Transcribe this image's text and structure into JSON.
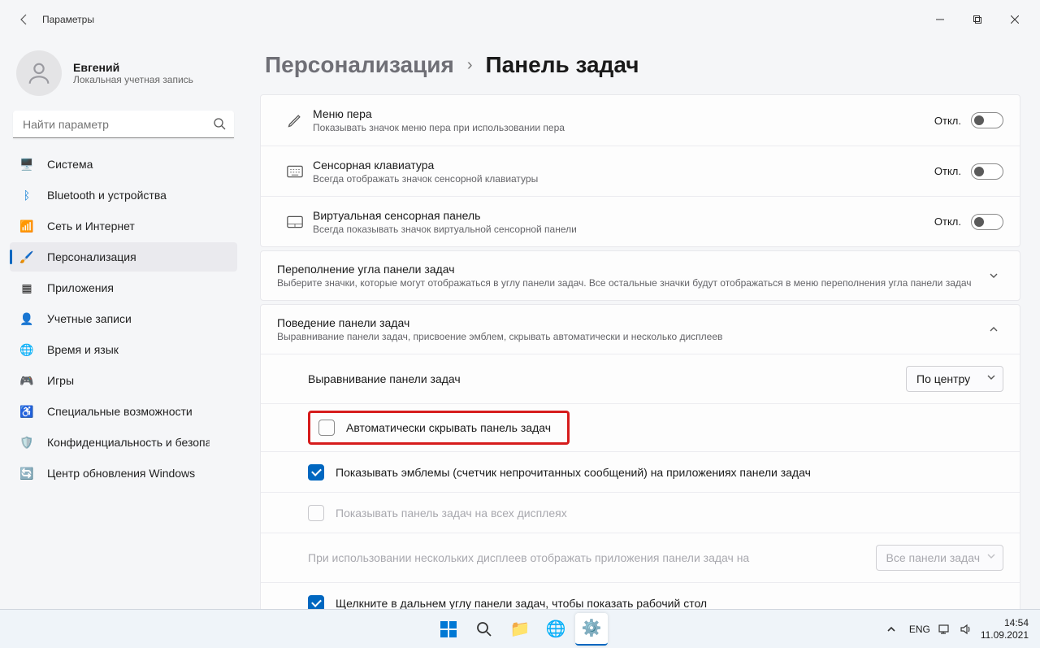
{
  "window": {
    "title": "Параметры"
  },
  "user": {
    "name": "Евгений",
    "subtitle": "Локальная учетная запись"
  },
  "search": {
    "placeholder": "Найти параметр"
  },
  "nav": [
    {
      "label": "Система"
    },
    {
      "label": "Bluetooth и устройства"
    },
    {
      "label": "Сеть и Интернет"
    },
    {
      "label": "Персонализация"
    },
    {
      "label": "Приложения"
    },
    {
      "label": "Учетные записи"
    },
    {
      "label": "Время и язык"
    },
    {
      "label": "Игры"
    },
    {
      "label": "Специальные возможности"
    },
    {
      "label": "Конфиденциальность и безопасность"
    },
    {
      "label": "Центр обновления Windows"
    }
  ],
  "breadcrumb": {
    "parent": "Персонализация",
    "current": "Панель задач"
  },
  "toggles": {
    "off_label": "Откл."
  },
  "items": {
    "pen": {
      "title": "Меню пера",
      "sub": "Показывать значок меню пера при использовании пера"
    },
    "touchkb": {
      "title": "Сенсорная клавиатура",
      "sub": "Всегда отображать значок сенсорной клавиатуры"
    },
    "touchpad": {
      "title": "Виртуальная сенсорная панель",
      "sub": "Всегда показывать значок виртуальной сенсорной панели"
    }
  },
  "overflow": {
    "title": "Переполнение угла панели задач",
    "sub": "Выберите значки, которые могут отображаться в углу панели задач. Все остальные значки будут отображаться в меню переполнения угла панели задач"
  },
  "behavior": {
    "title": "Поведение панели задач",
    "sub": "Выравнивание панели задач, присвоение эмблем, скрывать автоматически и несколько дисплеев",
    "align_label": "Выравнивание панели задач",
    "align_value": "По центру",
    "autohide": "Автоматически скрывать панель задач",
    "badges": "Показывать эмблемы (счетчик непрочитанных сообщений) на приложениях панели задач",
    "all_displays": "Показывать панель задач на всех дисплеях",
    "multi_label": "При использовании нескольких дисплеев отображать приложения панели задач на",
    "multi_value": "Все панели задач",
    "corner_click": "Щелкните в дальнем углу панели задач, чтобы показать рабочий стол"
  },
  "tray": {
    "lang": "ENG",
    "time": "14:54",
    "date": "11.09.2021"
  }
}
